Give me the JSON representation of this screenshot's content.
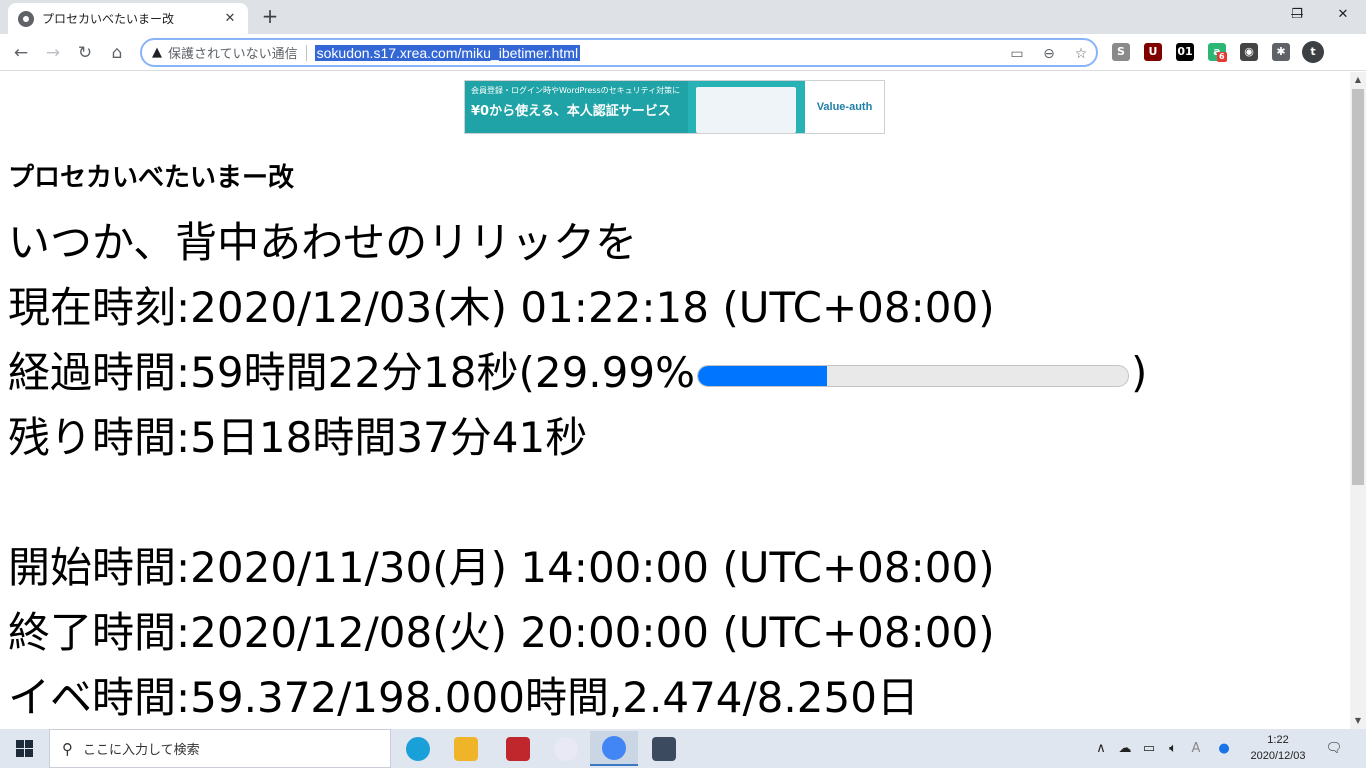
{
  "browser": {
    "tab_title": "プロセカいべたいまー改",
    "tab_close": "✕",
    "new_tab": "+",
    "window_controls": {
      "minimize": "—",
      "restore": "❐",
      "close": "✕"
    },
    "security_label": "保護されていない通信",
    "url": "sokudon.s17.xrea.com/miku_ibetimer.html",
    "icons": [
      "back-icon",
      "forward-icon",
      "reload-icon",
      "home-icon",
      "warning-icon",
      "cast-icon",
      "zoom-icon",
      "star-icon"
    ],
    "extensions": [
      {
        "name": "s-extension",
        "label": "S",
        "color": "#8a8a8a"
      },
      {
        "name": "ublock-extension",
        "label": "U",
        "color": "#800000"
      },
      {
        "name": "01-extension",
        "label": "01",
        "color": "#000000"
      },
      {
        "name": "a-extension",
        "label": "a",
        "color": "#2bb673",
        "badge": "6"
      },
      {
        "name": "mask-extension",
        "label": "◉",
        "color": "#444444"
      },
      {
        "name": "puzzle-extension",
        "label": "✱",
        "color": "#5f6368"
      },
      {
        "name": "profile-avatar",
        "label": "t",
        "color": "#3c4043"
      }
    ]
  },
  "banner": {
    "line1": "会員登録・ログイン時やWordPressのセキュリティ対策に",
    "line2": "¥0から使える、本人認証サービス",
    "logo": "Value-auth"
  },
  "page": {
    "heading": "プロセカいべたいまー改",
    "event_name": "いつか、背中あわせのリリックを",
    "current_time": "現在時刻:2020/12/03(木) 01:22:18 (UTC+08:00)",
    "elapsed_prefix": "経過時間:59時間22分18秒(29.99%",
    "elapsed_suffix": ")",
    "progress_percent": 29.99,
    "remaining": "残り時間:5日18時間37分41秒",
    "start": "開始時間:2020/11/30(月) 14:00:00 (UTC+08:00)",
    "end": "終了時間:2020/12/08(火) 20:00:00 (UTC+08:00)",
    "event_hours": "イベ時間:59.372/198.000時間,2.474/8.250日"
  },
  "taskbar": {
    "search_placeholder": "ここに入力して検索",
    "apps": [
      {
        "name": "edge-app",
        "color": "#1aa0d8"
      },
      {
        "name": "explorer-app",
        "color": "#f0b429"
      },
      {
        "name": "filezilla-app",
        "color": "#c0272d"
      },
      {
        "name": "itunes-app",
        "color": "#e9e9f5"
      },
      {
        "name": "chrome-app",
        "color": "#4285f4",
        "active": true
      },
      {
        "name": "media-app",
        "color": "#3b4a5e"
      }
    ],
    "tray": {
      "chevron": "∧",
      "ime": "A"
    },
    "time": "1:22",
    "date": "2020/12/03"
  }
}
